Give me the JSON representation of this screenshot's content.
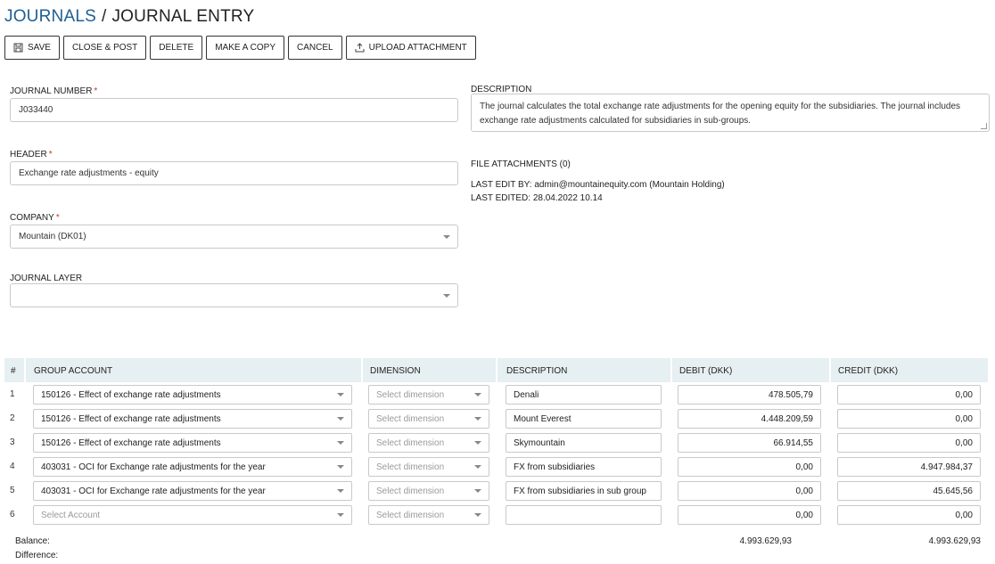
{
  "breadcrumb": {
    "parent": "JOURNALS",
    "separator": "/",
    "current": "JOURNAL ENTRY"
  },
  "toolbar": {
    "save": "SAVE",
    "close_post": "CLOSE & POST",
    "delete": "DELETE",
    "make_copy": "MAKE A COPY",
    "cancel": "CANCEL",
    "upload": "UPLOAD ATTACHMENT"
  },
  "form": {
    "journal_number": {
      "label": "JOURNAL NUMBER",
      "required": "*",
      "value": "J033440"
    },
    "header": {
      "label": "HEADER",
      "required": "*",
      "value": "Exchange rate adjustments - equity"
    },
    "company": {
      "label": "COMPANY",
      "required": "*",
      "value": "Mountain (DK01)"
    },
    "journal_layer": {
      "label": "JOURNAL LAYER",
      "value": ""
    },
    "description": {
      "label": "DESCRIPTION",
      "value": "The journal calculates the total exchange rate adjustments for the opening equity for the subsidiaries. The journal includes exchange rate adjustments calculated for subsidiaries in sub-groups."
    }
  },
  "meta": {
    "attachments": "FILE ATTACHMENTS (0)",
    "last_edit_by_label": "LAST EDIT BY:",
    "last_edit_by": "admin@mountainequity.com (Mountain Holding)",
    "last_edited_label": "LAST EDITED:",
    "last_edited": "28.04.2022 10.14"
  },
  "table": {
    "headers": {
      "num": "#",
      "account": "GROUP ACCOUNT",
      "dimension": "DIMENSION",
      "description": "DESCRIPTION",
      "debit": "DEBIT (DKK)",
      "credit": "CREDIT (DKK)"
    },
    "rows": [
      {
        "num": "1",
        "account": "150126 - Effect of exchange rate adjustments",
        "dimension": "Select dimension",
        "description": "Denali",
        "debit": "478.505,79",
        "credit": "0,00"
      },
      {
        "num": "2",
        "account": "150126 - Effect of exchange rate adjustments",
        "dimension": "Select dimension",
        "description": "Mount Everest",
        "debit": "4.448.209,59",
        "credit": "0,00"
      },
      {
        "num": "3",
        "account": "150126 - Effect of exchange rate adjustments",
        "dimension": "Select dimension",
        "description": "Skymountain",
        "debit": "66.914,55",
        "credit": "0,00"
      },
      {
        "num": "4",
        "account": "403031 - OCI for Exchange rate adjustments for the year",
        "dimension": "Select dimension",
        "description": "FX from subsidiaries",
        "debit": "0,00",
        "credit": "4.947.984,37"
      },
      {
        "num": "5",
        "account": "403031 - OCI for Exchange rate adjustments for the year",
        "dimension": "Select dimension",
        "description": "FX from subsidiaries in sub group",
        "debit": "0,00",
        "credit": "45.645,56"
      },
      {
        "num": "6",
        "account": "Select Account",
        "dimension": "Select dimension",
        "description": "",
        "debit": "0,00",
        "credit": "0,00"
      }
    ],
    "balance_label": "Balance:",
    "difference_label": "Difference:",
    "balance_debit": "4.993.629,93",
    "balance_credit": "4.993.629,93"
  },
  "colors": {
    "breadcrumb_link": "#1f5f93",
    "header_bg": "#e6eff2",
    "required": "#c0392b"
  },
  "icons": {
    "save": "floppy-disk-icon",
    "upload": "upload-icon",
    "dropdown": "chevron-down-icon"
  }
}
